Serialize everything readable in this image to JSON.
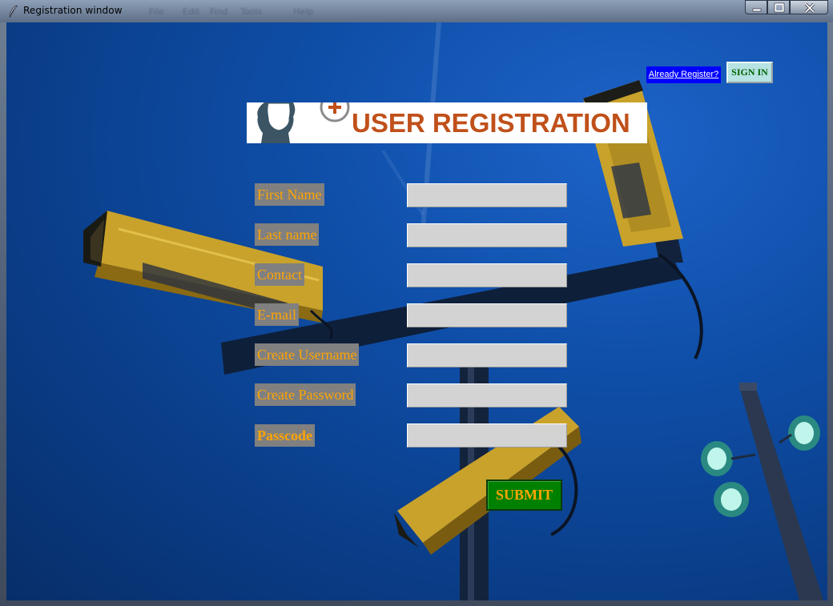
{
  "window": {
    "title": "Registration window",
    "ghost_menu": [
      "File",
      "Edit",
      "Find",
      "Tools",
      "Help"
    ]
  },
  "caption": {
    "minimize": "minimize-icon",
    "maximize": "maximize-icon",
    "close": "close-icon"
  },
  "header": {
    "already_register_link": "Already Register?",
    "sign_in_button": "SIGN IN",
    "banner_text": "USER REGISTRATION"
  },
  "form": {
    "fields": [
      {
        "label": "First Name",
        "value": ""
      },
      {
        "label": "Last name",
        "value": ""
      },
      {
        "label": "Contact",
        "value": ""
      },
      {
        "label": "E-mail",
        "value": ""
      },
      {
        "label": "Create Username",
        "value": ""
      },
      {
        "label": "Create Password",
        "value": ""
      },
      {
        "label": "Passcode",
        "value": ""
      }
    ],
    "submit_label": "SUBMIT"
  },
  "colors": {
    "label_bg": "#808080",
    "label_text": "#ffa500",
    "input_bg": "#d3d3d3",
    "submit_bg": "#008000",
    "signin_bg": "#b7e3e3",
    "banner_text": "#c0501a",
    "link_bg": "#0000ff"
  }
}
